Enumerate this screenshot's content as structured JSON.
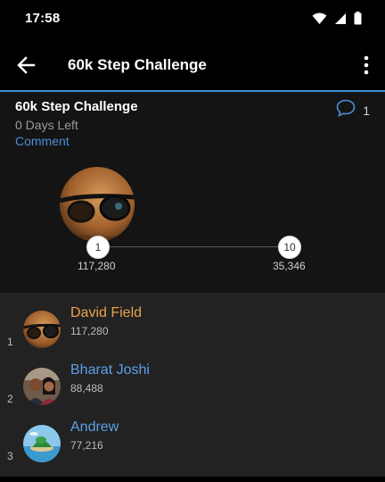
{
  "status_bar": {
    "time": "17:58"
  },
  "app_bar": {
    "title": "60k Step Challenge"
  },
  "header": {
    "challenge_title": "60k Step Challenge",
    "days_left": "0 Days Left",
    "comment_label": "Comment",
    "comment_count": "1"
  },
  "progress": {
    "start_rank": "1",
    "start_steps": "117,280",
    "end_rank": "10",
    "end_steps": "35,346"
  },
  "leaderboard": [
    {
      "rank": "1",
      "name": "David Field",
      "steps": "117,280"
    },
    {
      "rank": "2",
      "name": "Bharat Joshi",
      "steps": "88,488"
    },
    {
      "rank": "3",
      "name": "Andrew",
      "steps": "77,216"
    }
  ],
  "colors": {
    "accent": "#3d8fd6",
    "leader_name": "#e8a24a",
    "name": "#5aa0e6"
  }
}
